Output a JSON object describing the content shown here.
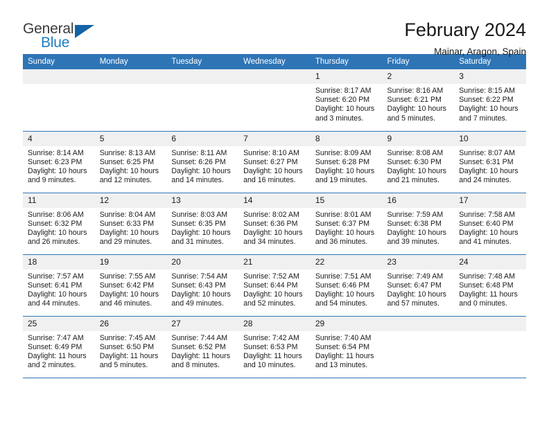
{
  "logo": {
    "word_one": "General",
    "word_two": "Blue",
    "triangle_color": "#1464a5"
  },
  "header": {
    "month_title": "February 2024",
    "location": "Mainar, Aragon, Spain"
  },
  "theme": {
    "header_blue": "#2e75b6",
    "daynum_band": "#f0f0f0",
    "row_rule": "#2e75b6",
    "text": "#1a1a1a"
  },
  "calendar": {
    "weekday_headers": [
      "Sunday",
      "Monday",
      "Tuesday",
      "Wednesday",
      "Thursday",
      "Friday",
      "Saturday"
    ],
    "weeks": [
      [
        {
          "day": ""
        },
        {
          "day": ""
        },
        {
          "day": ""
        },
        {
          "day": ""
        },
        {
          "day": "1",
          "sunrise": "Sunrise: 8:17 AM",
          "sunset": "Sunset: 6:20 PM",
          "daylight_line1": "Daylight: 10 hours",
          "daylight_line2": "and 3 minutes."
        },
        {
          "day": "2",
          "sunrise": "Sunrise: 8:16 AM",
          "sunset": "Sunset: 6:21 PM",
          "daylight_line1": "Daylight: 10 hours",
          "daylight_line2": "and 5 minutes."
        },
        {
          "day": "3",
          "sunrise": "Sunrise: 8:15 AM",
          "sunset": "Sunset: 6:22 PM",
          "daylight_line1": "Daylight: 10 hours",
          "daylight_line2": "and 7 minutes."
        }
      ],
      [
        {
          "day": "4",
          "sunrise": "Sunrise: 8:14 AM",
          "sunset": "Sunset: 6:23 PM",
          "daylight_line1": "Daylight: 10 hours",
          "daylight_line2": "and 9 minutes."
        },
        {
          "day": "5",
          "sunrise": "Sunrise: 8:13 AM",
          "sunset": "Sunset: 6:25 PM",
          "daylight_line1": "Daylight: 10 hours",
          "daylight_line2": "and 12 minutes."
        },
        {
          "day": "6",
          "sunrise": "Sunrise: 8:11 AM",
          "sunset": "Sunset: 6:26 PM",
          "daylight_line1": "Daylight: 10 hours",
          "daylight_line2": "and 14 minutes."
        },
        {
          "day": "7",
          "sunrise": "Sunrise: 8:10 AM",
          "sunset": "Sunset: 6:27 PM",
          "daylight_line1": "Daylight: 10 hours",
          "daylight_line2": "and 16 minutes."
        },
        {
          "day": "8",
          "sunrise": "Sunrise: 8:09 AM",
          "sunset": "Sunset: 6:28 PM",
          "daylight_line1": "Daylight: 10 hours",
          "daylight_line2": "and 19 minutes."
        },
        {
          "day": "9",
          "sunrise": "Sunrise: 8:08 AM",
          "sunset": "Sunset: 6:30 PM",
          "daylight_line1": "Daylight: 10 hours",
          "daylight_line2": "and 21 minutes."
        },
        {
          "day": "10",
          "sunrise": "Sunrise: 8:07 AM",
          "sunset": "Sunset: 6:31 PM",
          "daylight_line1": "Daylight: 10 hours",
          "daylight_line2": "and 24 minutes."
        }
      ],
      [
        {
          "day": "11",
          "sunrise": "Sunrise: 8:06 AM",
          "sunset": "Sunset: 6:32 PM",
          "daylight_line1": "Daylight: 10 hours",
          "daylight_line2": "and 26 minutes."
        },
        {
          "day": "12",
          "sunrise": "Sunrise: 8:04 AM",
          "sunset": "Sunset: 6:33 PM",
          "daylight_line1": "Daylight: 10 hours",
          "daylight_line2": "and 29 minutes."
        },
        {
          "day": "13",
          "sunrise": "Sunrise: 8:03 AM",
          "sunset": "Sunset: 6:35 PM",
          "daylight_line1": "Daylight: 10 hours",
          "daylight_line2": "and 31 minutes."
        },
        {
          "day": "14",
          "sunrise": "Sunrise: 8:02 AM",
          "sunset": "Sunset: 6:36 PM",
          "daylight_line1": "Daylight: 10 hours",
          "daylight_line2": "and 34 minutes."
        },
        {
          "day": "15",
          "sunrise": "Sunrise: 8:01 AM",
          "sunset": "Sunset: 6:37 PM",
          "daylight_line1": "Daylight: 10 hours",
          "daylight_line2": "and 36 minutes."
        },
        {
          "day": "16",
          "sunrise": "Sunrise: 7:59 AM",
          "sunset": "Sunset: 6:38 PM",
          "daylight_line1": "Daylight: 10 hours",
          "daylight_line2": "and 39 minutes."
        },
        {
          "day": "17",
          "sunrise": "Sunrise: 7:58 AM",
          "sunset": "Sunset: 6:40 PM",
          "daylight_line1": "Daylight: 10 hours",
          "daylight_line2": "and 41 minutes."
        }
      ],
      [
        {
          "day": "18",
          "sunrise": "Sunrise: 7:57 AM",
          "sunset": "Sunset: 6:41 PM",
          "daylight_line1": "Daylight: 10 hours",
          "daylight_line2": "and 44 minutes."
        },
        {
          "day": "19",
          "sunrise": "Sunrise: 7:55 AM",
          "sunset": "Sunset: 6:42 PM",
          "daylight_line1": "Daylight: 10 hours",
          "daylight_line2": "and 46 minutes."
        },
        {
          "day": "20",
          "sunrise": "Sunrise: 7:54 AM",
          "sunset": "Sunset: 6:43 PM",
          "daylight_line1": "Daylight: 10 hours",
          "daylight_line2": "and 49 minutes."
        },
        {
          "day": "21",
          "sunrise": "Sunrise: 7:52 AM",
          "sunset": "Sunset: 6:44 PM",
          "daylight_line1": "Daylight: 10 hours",
          "daylight_line2": "and 52 minutes."
        },
        {
          "day": "22",
          "sunrise": "Sunrise: 7:51 AM",
          "sunset": "Sunset: 6:46 PM",
          "daylight_line1": "Daylight: 10 hours",
          "daylight_line2": "and 54 minutes."
        },
        {
          "day": "23",
          "sunrise": "Sunrise: 7:49 AM",
          "sunset": "Sunset: 6:47 PM",
          "daylight_line1": "Daylight: 10 hours",
          "daylight_line2": "and 57 minutes."
        },
        {
          "day": "24",
          "sunrise": "Sunrise: 7:48 AM",
          "sunset": "Sunset: 6:48 PM",
          "daylight_line1": "Daylight: 11 hours",
          "daylight_line2": "and 0 minutes."
        }
      ],
      [
        {
          "day": "25",
          "sunrise": "Sunrise: 7:47 AM",
          "sunset": "Sunset: 6:49 PM",
          "daylight_line1": "Daylight: 11 hours",
          "daylight_line2": "and 2 minutes."
        },
        {
          "day": "26",
          "sunrise": "Sunrise: 7:45 AM",
          "sunset": "Sunset: 6:50 PM",
          "daylight_line1": "Daylight: 11 hours",
          "daylight_line2": "and 5 minutes."
        },
        {
          "day": "27",
          "sunrise": "Sunrise: 7:44 AM",
          "sunset": "Sunset: 6:52 PM",
          "daylight_line1": "Daylight: 11 hours",
          "daylight_line2": "and 8 minutes."
        },
        {
          "day": "28",
          "sunrise": "Sunrise: 7:42 AM",
          "sunset": "Sunset: 6:53 PM",
          "daylight_line1": "Daylight: 11 hours",
          "daylight_line2": "and 10 minutes."
        },
        {
          "day": "29",
          "sunrise": "Sunrise: 7:40 AM",
          "sunset": "Sunset: 6:54 PM",
          "daylight_line1": "Daylight: 11 hours",
          "daylight_line2": "and 13 minutes."
        },
        {
          "day": ""
        },
        {
          "day": ""
        }
      ]
    ]
  }
}
